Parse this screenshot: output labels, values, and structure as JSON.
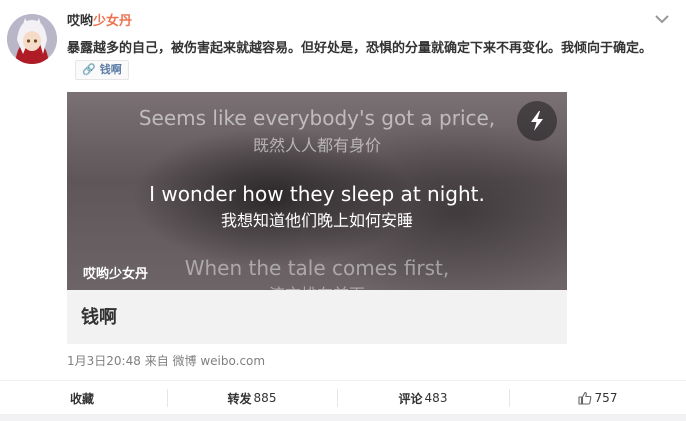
{
  "post": {
    "username_part1": "哎哟",
    "username_part2": "少女丹",
    "text": "暴露越多的自己，被伤害起来就越容易。但好处是，恐惧的分量就确定下来不再变化。我倾向于确定。",
    "link_chip_label": "钱啊",
    "meta": {
      "time": "1月3日20:48",
      "from_label": "来自",
      "source": "微博 weibo.com"
    }
  },
  "card": {
    "lyrics": {
      "prev_en": "Seems like everybody's got a price,",
      "prev_cn": "既然人人都有身价",
      "current_en": "I wonder how they sleep at night.",
      "current_cn": "我想知道他们晚上如何安睡",
      "next_en": "When the tale comes first,",
      "next_cn": "流言排在前面"
    },
    "watermark": "哎哟少女丹",
    "title": "钱啊",
    "flash_icon": "lightning-bolt-icon"
  },
  "actions": {
    "favorite_label": "收藏",
    "repost_label": "转发",
    "repost_count": "885",
    "comment_label": "评论",
    "comment_count": "483",
    "like_count": "757"
  },
  "colors": {
    "username_highlight": "#eb7350",
    "link": "#5e7ea8",
    "muted": "#808080"
  }
}
